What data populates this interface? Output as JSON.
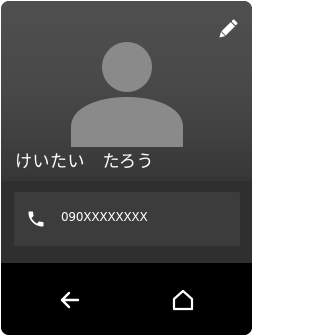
{
  "contact": {
    "name": "けいたい　たろう",
    "phone_number": "090XXXXXXXX"
  },
  "icons": {
    "edit": "pencil-icon",
    "avatar": "person-silhouette-icon",
    "phone": "phone-icon",
    "back": "arrow-left-icon",
    "home": "home-icon"
  },
  "colors": {
    "header_top": "#4f4f4f",
    "header_bottom": "#363636",
    "body_bg": "#2f2f2f",
    "card_bg": "#3c3c3c",
    "avatar_fill": "#8a8a8a",
    "nav_bg": "#000000",
    "text": "#ffffff"
  }
}
